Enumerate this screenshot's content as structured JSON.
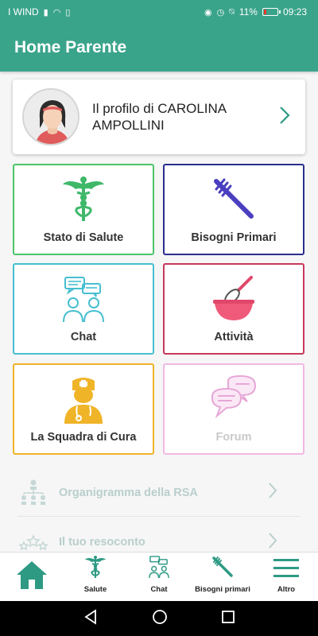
{
  "status_bar": {
    "carrier": "I WIND",
    "battery": "11%",
    "time": "09:23",
    "battery_color": "#e23a2a"
  },
  "app_bar": {
    "title": "Home Parente"
  },
  "profile": {
    "name": "Il profilo di CAROLINA AMPOLLINI"
  },
  "tiles": [
    {
      "label": "Stato di Salute",
      "icon": "caduceus-icon",
      "color": "#4cc46a"
    },
    {
      "label": "Bisogni Primari",
      "icon": "toothbrush-icon",
      "color": "#2b2f8f"
    },
    {
      "label": "Chat",
      "icon": "chat-people-icon",
      "color": "#46bfd0"
    },
    {
      "label": "Attività",
      "icon": "whisk-bowl-icon",
      "color": "#c8385a"
    },
    {
      "label": "La Squadra di Cura",
      "icon": "doctor-icon",
      "color": "#f0b429"
    },
    {
      "label": "Forum",
      "icon": "speech-bubbles-icon",
      "color": "#f2b8e4"
    }
  ],
  "list": [
    {
      "label": "Organigramma della RSA",
      "icon": "org-chart-icon"
    },
    {
      "label": "Il tuo resoconto",
      "icon": "stars-icon"
    }
  ],
  "bottom_nav": [
    {
      "label": "",
      "icon": "home-icon"
    },
    {
      "label": "Salute",
      "icon": "caduceus-icon"
    },
    {
      "label": "Chat",
      "icon": "chat-people-icon"
    },
    {
      "label": "Bisogni primari",
      "icon": "toothbrush-icon"
    },
    {
      "label": "Altro",
      "icon": "menu-icon"
    }
  ],
  "colors": {
    "primary": "#3aa48b",
    "accent_nav": "#2e9a84"
  }
}
